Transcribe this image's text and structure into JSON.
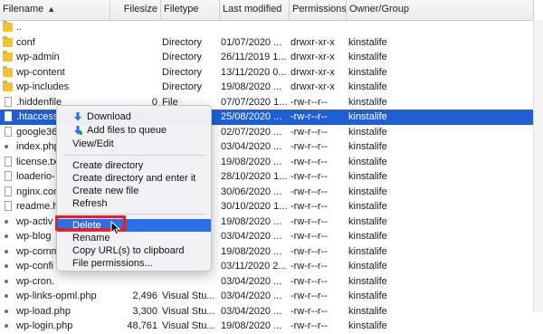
{
  "header": {
    "columns": [
      "Filename",
      "Filesize",
      "Filetype",
      "Last modified",
      "Permissions",
      "Owner/Group"
    ]
  },
  "rows": [
    {
      "name": "..",
      "size": "",
      "type": "",
      "modified": "",
      "perms": "",
      "owner": "",
      "icon": "folder",
      "selected": false
    },
    {
      "name": "conf",
      "size": "",
      "type": "Directory",
      "modified": "01/07/2020 ...",
      "perms": "drwxr-xr-x",
      "owner": "kinstalife",
      "icon": "folder",
      "selected": false
    },
    {
      "name": "wp-admin",
      "size": "",
      "type": "Directory",
      "modified": "26/11/2019 1...",
      "perms": "drwxr-xr-x",
      "owner": "kinstalife",
      "icon": "folder",
      "selected": false
    },
    {
      "name": "wp-content",
      "size": "",
      "type": "Directory",
      "modified": "13/11/2020 0...",
      "perms": "drwxr-xr-x",
      "owner": "kinstalife",
      "icon": "folder",
      "selected": false
    },
    {
      "name": "wp-includes",
      "size": "",
      "type": "Directory",
      "modified": "19/08/2020 ...",
      "perms": "drwxr-xr-x",
      "owner": "kinstalife",
      "icon": "folder",
      "selected": false
    },
    {
      "name": ".hiddenfile",
      "size": "0",
      "type": "File",
      "modified": "07/07/2020 1...",
      "perms": "-rw-r--r--",
      "owner": "kinstalife",
      "icon": "file",
      "selected": false
    },
    {
      "name": ".htaccess",
      "size": "",
      "type": "",
      "modified": "25/08/2020 ...",
      "perms": "-rw-r--r--",
      "owner": "kinstalife",
      "icon": "file",
      "selected": true
    },
    {
      "name": "google36",
      "size": "",
      "type": "",
      "modified": "02/07/2020 ...",
      "perms": "-rw-r--r--",
      "owner": "kinstalife",
      "icon": "file",
      "selected": false
    },
    {
      "name": "index.php",
      "size": "",
      "type": "",
      "modified": "03/04/2020 ...",
      "perms": "-rw-r--r--",
      "owner": "kinstalife",
      "icon": "dot",
      "selected": false
    },
    {
      "name": "license.tx",
      "size": "",
      "type": "",
      "modified": "19/08/2020 ...",
      "perms": "-rw-r--r--",
      "owner": "kinstalife",
      "icon": "file",
      "selected": false
    },
    {
      "name": "loaderio-",
      "size": "",
      "type": "",
      "modified": "28/10/2020 1...",
      "perms": "-rw-r--r--",
      "owner": "kinstalife",
      "icon": "file",
      "selected": false
    },
    {
      "name": "nginx.con",
      "size": "",
      "type": "",
      "modified": "30/06/2020 ...",
      "perms": "-rw-r--r--",
      "owner": "kinstalife",
      "icon": "file",
      "selected": false
    },
    {
      "name": "readme.h",
      "size": "",
      "type": "",
      "modified": "30/10/2020 1...",
      "perms": "-rw-r--r--",
      "owner": "kinstalife",
      "icon": "file",
      "selected": false
    },
    {
      "name": "wp-activ",
      "size": "",
      "type": "",
      "modified": "19/08/2020 ...",
      "perms": "-rw-r--r--",
      "owner": "kinstalife",
      "icon": "dot",
      "selected": false
    },
    {
      "name": "wp-blog",
      "size": "",
      "type": "",
      "modified": "03/04/2020 ...",
      "perms": "-rw-r--r--",
      "owner": "kinstalife",
      "icon": "dot",
      "selected": false
    },
    {
      "name": "wp-comm",
      "size": "",
      "type": "",
      "modified": "19/08/2020 ...",
      "perms": "-rw-r--r--",
      "owner": "kinstalife",
      "icon": "dot",
      "selected": false
    },
    {
      "name": "wp-confi",
      "size": "",
      "type": "",
      "modified": "03/11/2020 2...",
      "perms": "-rw-r--r--",
      "owner": "kinstalife",
      "icon": "dot",
      "selected": false
    },
    {
      "name": "wp-cron.",
      "size": "",
      "type": "",
      "modified": "03/04/2020 ...",
      "perms": "-rw-r--r--",
      "owner": "kinstalife",
      "icon": "dot",
      "selected": false
    },
    {
      "name": "wp-links-opml.php",
      "size": "2,496",
      "type": "Visual Stu...",
      "modified": "03/04/2020 ...",
      "perms": "-rw-r--r--",
      "owner": "kinstalife",
      "icon": "dot",
      "selected": false
    },
    {
      "name": "wp-load.php",
      "size": "3,300",
      "type": "Visual Stu...",
      "modified": "03/04/2020 ...",
      "perms": "-rw-r--r--",
      "owner": "kinstalife",
      "icon": "dot",
      "selected": false
    },
    {
      "name": "wp-login.php",
      "size": "48,761",
      "type": "Visual Stu...",
      "modified": "19/08/2020 ...",
      "perms": "-rw-r--r--",
      "owner": "kinstalife",
      "icon": "dot",
      "selected": false
    }
  ],
  "menu": {
    "download": "Download",
    "add_to_queue": "Add files to queue",
    "view_edit": "View/Edit",
    "create_directory": "Create directory",
    "create_directory_enter": "Create directory and enter it",
    "create_new_file": "Create new file",
    "refresh": "Refresh",
    "delete": "Delete",
    "rename": "Rename",
    "copy_urls": "Copy URL(s) to clipboard",
    "file_permissions": "File permissions..."
  },
  "colors": {
    "selection": "#1f5fd4",
    "menu_highlight": "#2a6ee8",
    "annotation_box": "#d7252b",
    "folder": "#f2c232"
  },
  "icons": {
    "download": "down-arrow-icon",
    "add_to_queue": "add-to-queue-icon",
    "sort": "chevron-up-icon"
  }
}
